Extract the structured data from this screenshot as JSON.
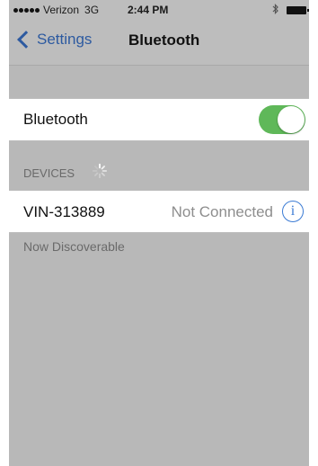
{
  "status_bar": {
    "carrier": "Verizon",
    "network": "3G",
    "time": "2:44 PM",
    "icons": [
      "signal-dots",
      "bluetooth-icon",
      "battery-icon"
    ]
  },
  "nav": {
    "back_label": "Settings",
    "title": "Bluetooth"
  },
  "bluetooth": {
    "label": "Bluetooth",
    "enabled": true,
    "toggle_color": "#5fb859"
  },
  "devices": {
    "header": "DEVICES",
    "items": [
      {
        "name": "VIN-313889",
        "status": "Not Connected"
      }
    ]
  },
  "footer_text": "Now Discoverable",
  "colors": {
    "accent": "#2d5aa0",
    "info_icon": "#3b7bd4",
    "background": "#bdbdbd"
  }
}
